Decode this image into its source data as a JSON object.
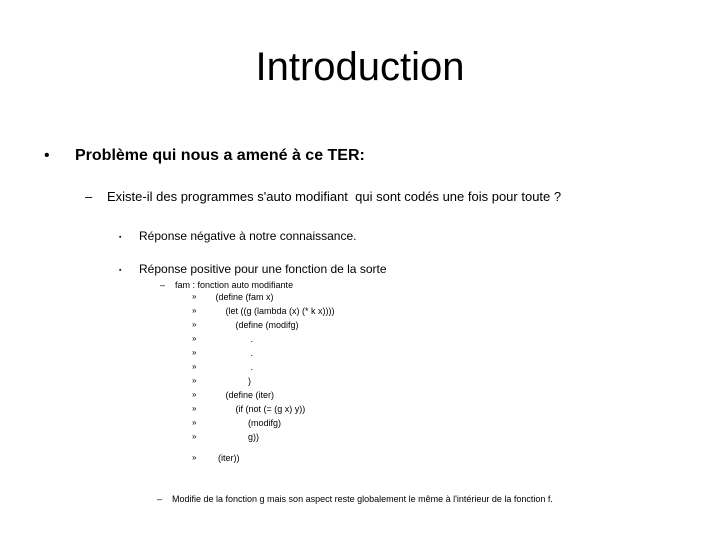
{
  "slide": {
    "title": "Introduction",
    "background_color": "#ffffff",
    "text_color": "#000000"
  },
  "markers": {
    "level1": "•",
    "level2": "–",
    "level3": "▪",
    "level4": "–",
    "level5": "»"
  },
  "body": {
    "bullet1": "Problème qui nous a amené à ce TER:",
    "bullet2": "Existe-il des programmes s'auto modifiant  qui sont codés une fois pour toute ?",
    "bullet3a": "Réponse négative à notre connaissance.",
    "bullet3b": "Réponse positive pour une fonction de la sorte",
    "bullet4": "fam : fonction auto modifiante",
    "code": [
      "   (define (fam x)",
      "       (let ((g (lambda (x) (* k x))))",
      "           (define (modifg)",
      "                 .",
      "                 .",
      "                 .",
      "                )",
      "       (define (iter)",
      "           (if (not (= (g x) y))",
      "                (modifg)",
      "                g))",
      "    (iter))"
    ],
    "note": "Modifie de la fonction g mais son aspect reste globalement le même à l'intérieur de la fonction f."
  }
}
